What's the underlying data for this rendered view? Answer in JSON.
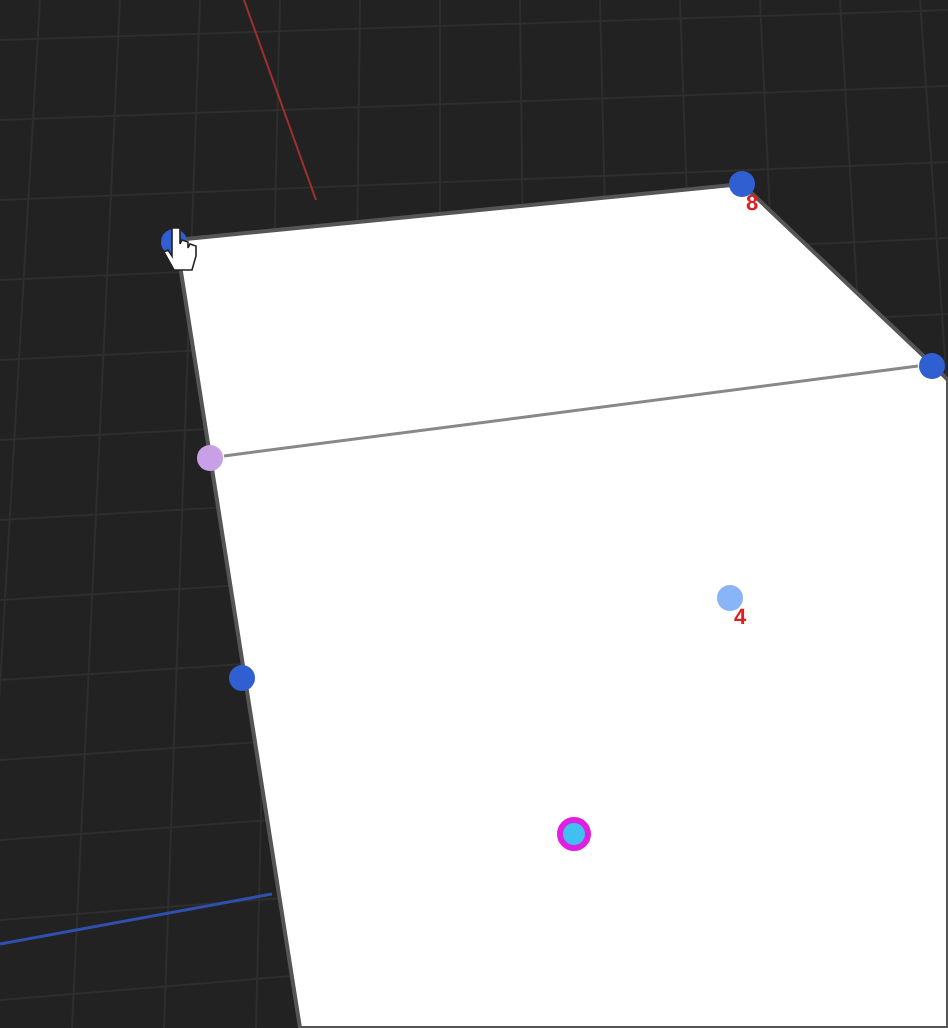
{
  "viewport": {
    "points": [
      {
        "color": "#2f5fd0"
      },
      {
        "color": "#2f5fd0",
        "label": "8"
      },
      {
        "color": "#2f5fd0"
      },
      {
        "color": "#c9a0e8"
      },
      {
        "color": "#2f5fd0"
      },
      {
        "color": "#8ab4f8",
        "label": "4"
      },
      {
        "color": "#e020e0",
        "selected": true
      }
    ]
  }
}
